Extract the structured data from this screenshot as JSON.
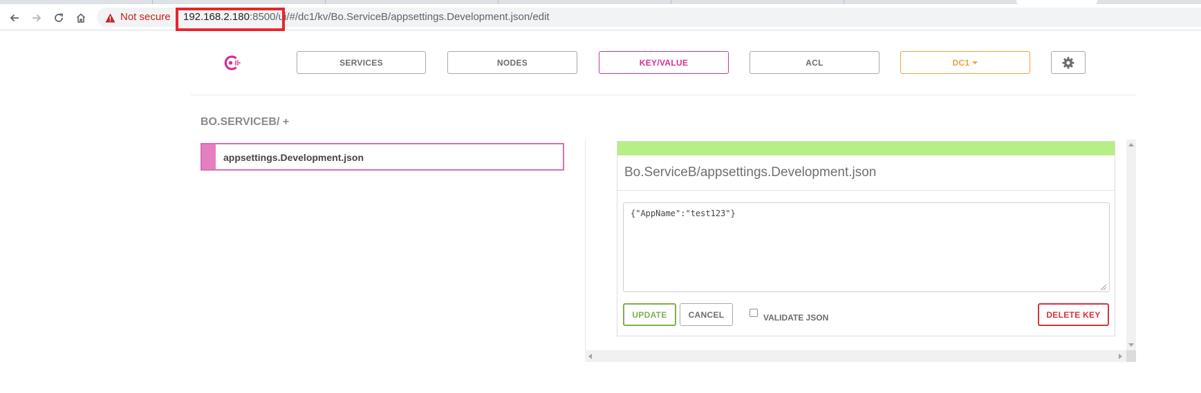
{
  "browser": {
    "not_secure": "Not secure",
    "url_host": "192.168.2.180",
    "url_rest": ":8500/ui/#/dc1/kv/Bo.ServiceB/appsettings.Development.json/edit"
  },
  "nav": {
    "services": "SERVICES",
    "nodes": "NODES",
    "keyvalue": "KEY/VALUE",
    "acl": "ACL",
    "datacenter": "DC1"
  },
  "colors": {
    "brand": "#d52f95",
    "datacenter": "#f0a03b",
    "success_bar": "#b5ef85",
    "update": "#7eae4f",
    "danger": "#d0353c",
    "url_highlight": "#e8262a"
  },
  "kv": {
    "breadcrumb": "BO.SERVICEB/ +",
    "items": [
      {
        "name": "appsettings.Development.json"
      }
    ]
  },
  "editor": {
    "title": "Bo.ServiceB/appsettings.Development.json",
    "value": "{\"AppName\":\"test123\"}",
    "update_label": "UPDATE",
    "cancel_label": "CANCEL",
    "validate_label": "VALIDATE JSON",
    "validate_checked": false,
    "delete_label": "DELETE KEY"
  },
  "icons": {
    "back": "arrow-left-icon",
    "forward": "arrow-right-icon",
    "reload": "reload-icon",
    "home": "home-icon",
    "warning": "warning-icon",
    "logo": "consul-logo-icon",
    "settings": "gear-icon"
  }
}
